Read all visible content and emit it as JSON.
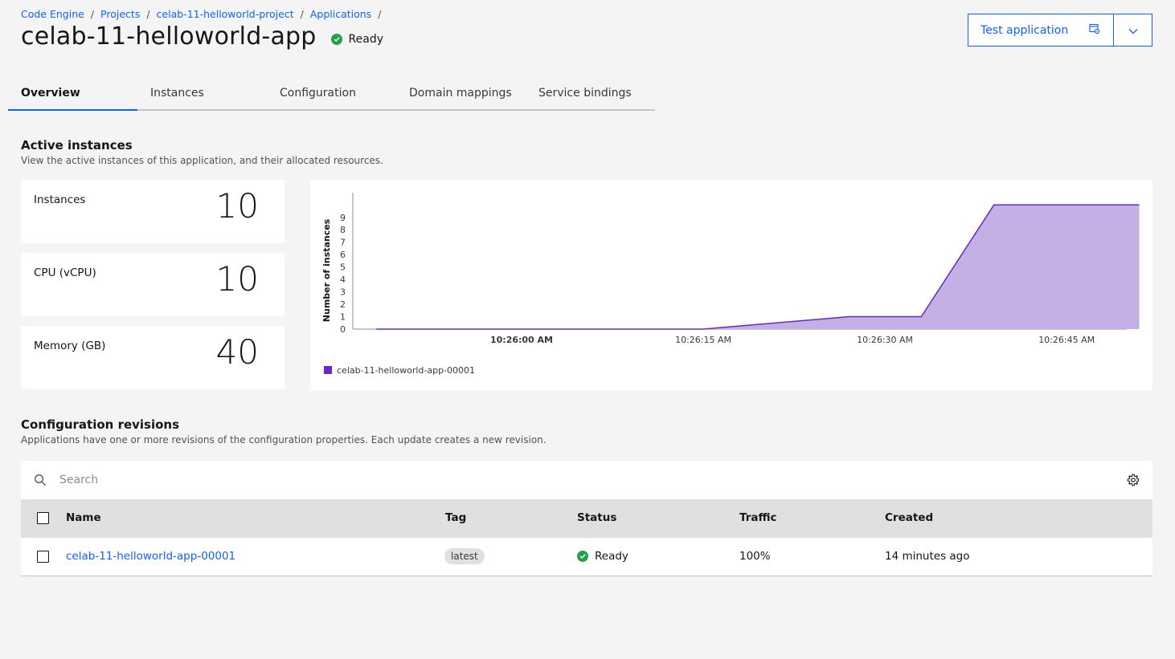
{
  "breadcrumb": [
    {
      "label": "Code Engine"
    },
    {
      "label": "Projects"
    },
    {
      "label": "celab-11-helloworld-project"
    },
    {
      "label": "Applications"
    }
  ],
  "breadcrumb_separator": "/",
  "page": {
    "title": "celab-11-helloworld-app",
    "status": "Ready",
    "status_color": "#24a148"
  },
  "actions": {
    "test_label": "Test application",
    "test_icon": "test-application-icon",
    "caret_icon": "chevron-down-icon"
  },
  "tabs": [
    {
      "label": "Overview",
      "active": true
    },
    {
      "label": "Instances"
    },
    {
      "label": "Configuration"
    },
    {
      "label": "Domain mappings"
    },
    {
      "label": "Service bindings"
    }
  ],
  "active_instances": {
    "title": "Active instances",
    "description": "View the active instances of this application, and their allocated resources.",
    "stats": [
      {
        "label": "Instances",
        "value": "10"
      },
      {
        "label": "CPU (vCPU)",
        "value": "10"
      },
      {
        "label": "Memory (GB)",
        "value": "40"
      }
    ]
  },
  "chart_data": {
    "type": "area",
    "ylabel": "Number of instances",
    "xlabel": "",
    "ylim": [
      0,
      10
    ],
    "y_ticks": [
      "0",
      "1",
      "2",
      "3",
      "4",
      "5",
      "6",
      "7",
      "8",
      "9"
    ],
    "x_ticks": [
      {
        "label": "10:26:00 AM",
        "bold": true
      },
      {
        "label": "10:26:15 AM"
      },
      {
        "label": "10:26:30 AM"
      },
      {
        "label": "10:26:45 AM"
      }
    ],
    "series": [
      {
        "name": "celab-11-helloworld-app-00001",
        "color": "#6929c4",
        "fill": "#c5b0e6",
        "x_seconds_after_10_26_00": [
          -12,
          15,
          27,
          33,
          39,
          51
        ],
        "values": [
          0,
          0,
          1,
          1,
          10,
          10
        ]
      }
    ],
    "legend_position": "bottom-left"
  },
  "revisions": {
    "title": "Configuration revisions",
    "description": "Applications have one or more revisions of the configuration properties. Each update creates a new revision.",
    "search_placeholder": "Search",
    "columns": [
      "Name",
      "Tag",
      "Status",
      "Traffic",
      "Created"
    ],
    "rows": [
      {
        "name": "celab-11-helloworld-app-00001",
        "tag": "latest",
        "status": "Ready",
        "traffic": "100%",
        "created": "14 minutes ago"
      }
    ]
  }
}
